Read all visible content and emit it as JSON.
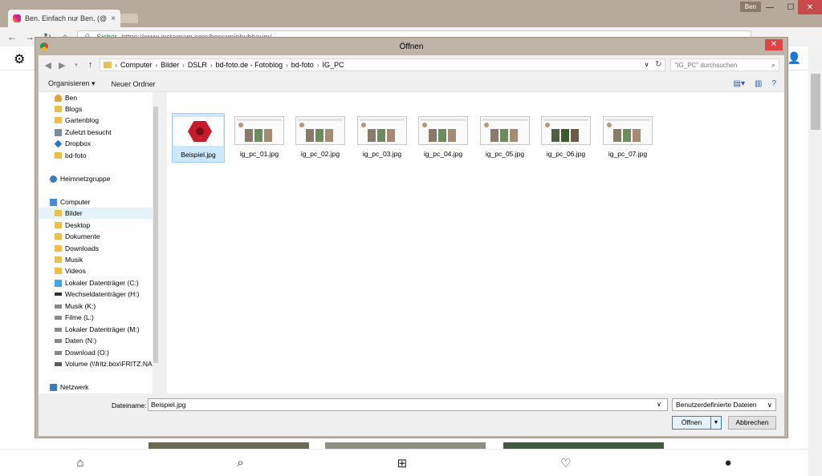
{
  "browser": {
    "tab_title": "Ben. Einfach nur Ben. (@",
    "tab_close": "×",
    "profile_name": "Ben",
    "secure_label": "Sicher",
    "url": "https://www.instagram.com/benjaminbuhbaum/",
    "win_controls": {
      "min": "—",
      "max": "☐",
      "close": "✕"
    }
  },
  "dialog": {
    "title": "Öffnen",
    "close": "✕",
    "breadcrumbs": [
      "Computer",
      "Bilder",
      "DSLR",
      "bd-foto.de - Fotoblog",
      "bd-foto",
      "IG_PC"
    ],
    "search_placeholder": "\"IG_PC\" durchsuchen",
    "organize": "Organisieren ▾",
    "new_folder": "Neuer Ordner",
    "nav_items": [
      {
        "label": "Ben",
        "icon": "user-folder-icon"
      },
      {
        "label": "Blogs",
        "icon": "folder-icon"
      },
      {
        "label": "Gartenblog",
        "icon": "folder-icon"
      },
      {
        "label": "Zuletzt besucht",
        "icon": "recent-places-icon"
      },
      {
        "label": "Dropbox",
        "icon": "dropbox-icon"
      },
      {
        "label": "bd-foto",
        "icon": "folder-icon"
      },
      {
        "label": "Heimnetzgruppe",
        "icon": "homegroup-icon"
      },
      {
        "label": "Computer",
        "icon": "computer-icon"
      },
      {
        "label": "Bilder",
        "icon": "pictures-folder-icon"
      },
      {
        "label": "Desktop",
        "icon": "desktop-folder-icon"
      },
      {
        "label": "Dokumente",
        "icon": "documents-folder-icon"
      },
      {
        "label": "Downloads",
        "icon": "downloads-folder-icon"
      },
      {
        "label": "Musik",
        "icon": "music-folder-icon"
      },
      {
        "label": "Videos",
        "icon": "videos-folder-icon"
      },
      {
        "label": "Lokaler Datenträger (C:)",
        "icon": "system-drive-icon"
      },
      {
        "label": "Wechseldatenträger (H:)",
        "icon": "removable-drive-icon"
      },
      {
        "label": "Musik (K:)",
        "icon": "drive-icon"
      },
      {
        "label": "Filme (L:)",
        "icon": "drive-icon"
      },
      {
        "label": "Lokaler Datenträger (M:)",
        "icon": "drive-icon"
      },
      {
        "label": "Daten (N:)",
        "icon": "drive-icon"
      },
      {
        "label": "Download (O:)",
        "icon": "drive-icon"
      },
      {
        "label": "Volume (\\\\fritz.box\\FRITZ.NA",
        "icon": "network-drive-icon"
      },
      {
        "label": "Netzwerk",
        "icon": "network-icon"
      }
    ],
    "selected_nav": "Bilder",
    "files": [
      "Beispiel.jpg",
      "ig_pc_01.jpg",
      "ig_pc_02.jpg",
      "ig_pc_03.jpg",
      "ig_pc_04.jpg",
      "ig_pc_05.jpg",
      "ig_pc_06.jpg",
      "ig_pc_07.jpg"
    ],
    "selected_file": "Beispiel.jpg",
    "filename_label": "Dateiname:",
    "filename_value": "Beispiel.jpg",
    "filter_value": "Benutzerdefinierte Dateien",
    "open_button": "Öffnen",
    "cancel_button": "Abbrechen"
  },
  "colors": {
    "chrome_frame": "#b7a99b",
    "selection": "#cce8ff",
    "close_red": "#e04343"
  }
}
